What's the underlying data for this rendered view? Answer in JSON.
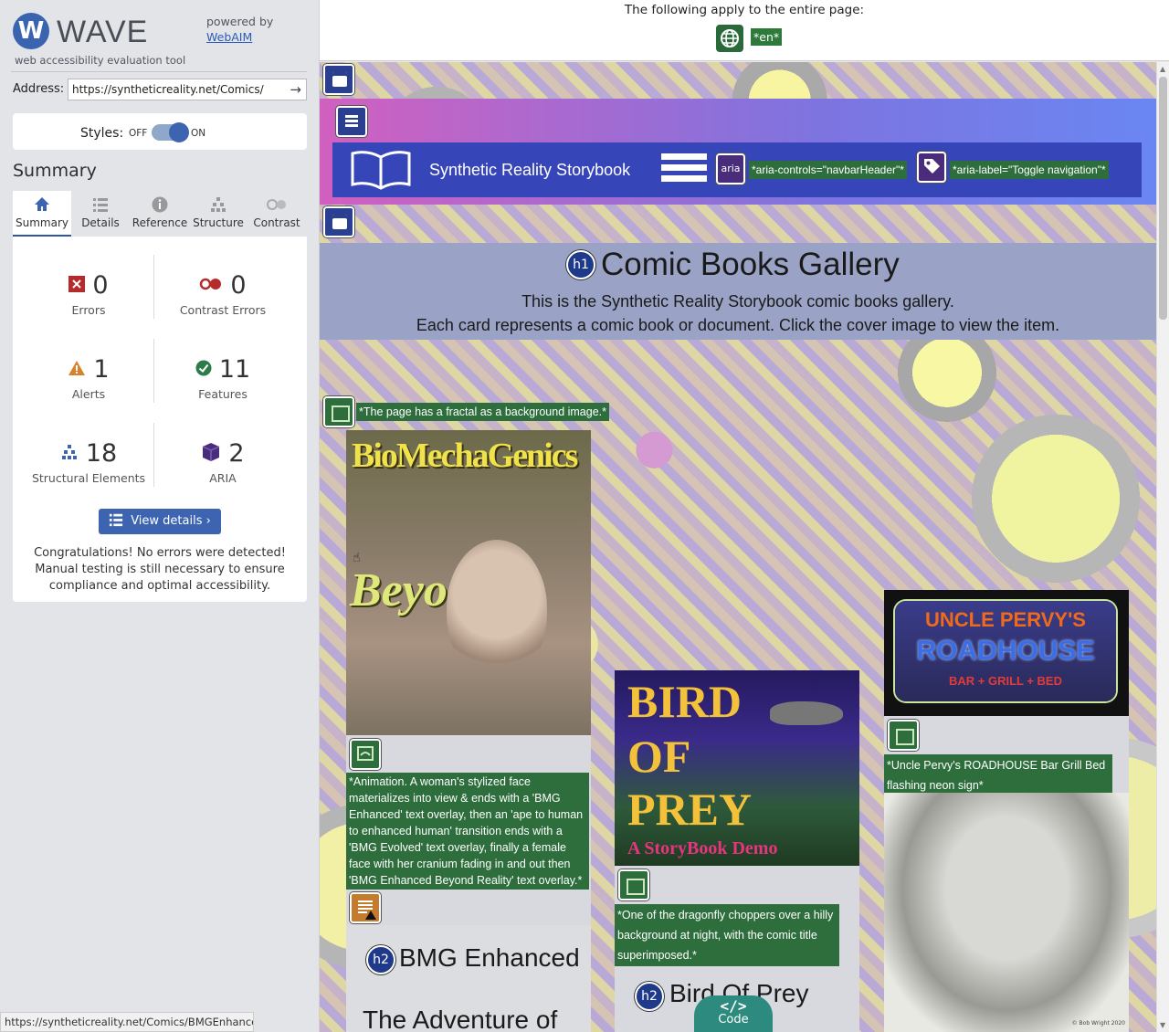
{
  "wave": {
    "logo_mark": "W",
    "logo_text": "WAVE",
    "logo_sub": "web accessibility evaluation tool",
    "powered_by": "powered by",
    "webaim_link": "WebAIM",
    "address_label": "Address:",
    "address_value": "https://syntheticreality.net/Comics/",
    "address_go": "→",
    "styles_label": "Styles:",
    "styles_off": "OFF",
    "styles_on": "ON",
    "summary_heading": "Summary",
    "tabs": [
      {
        "label": "Summary",
        "icon": "home-icon"
      },
      {
        "label": "Details",
        "icon": "list-icon"
      },
      {
        "label": "Reference",
        "icon": "info-icon"
      },
      {
        "label": "Structure",
        "icon": "structure-icon"
      },
      {
        "label": "Contrast",
        "icon": "contrast-icon"
      }
    ],
    "stats": {
      "errors": {
        "num": "0",
        "label": "Errors"
      },
      "contrast_errors": {
        "num": "0",
        "label": "Contrast Errors"
      },
      "alerts": {
        "num": "1",
        "label": "Alerts"
      },
      "features": {
        "num": "11",
        "label": "Features"
      },
      "structural": {
        "num": "18",
        "label": "Structural Elements"
      },
      "aria": {
        "num": "2",
        "label": "ARIA"
      }
    },
    "view_details": "View details ›",
    "congrats": "Congratulations! No errors were detected! Manual testing is still necessary to ensure compliance and optimal accessibility.",
    "status_url": "https://syntheticreality.net/Comics/BMGEnhanced.html"
  },
  "banner": {
    "text": "The following apply to the entire page:",
    "lang_badge": "*en*"
  },
  "page": {
    "brand": "Synthetic Reality Storybook",
    "aria_label_icon": "aria",
    "aria_controls": "*aria-controls=\"navbarHeader\"*",
    "aria_label": "*aria-label=\"Toggle navigation\"*",
    "h1_badge": "h1",
    "h1": "Comic Books Gallery",
    "sub1": "This is the Synthetic Reality Storybook comic books gallery.",
    "sub2": "Each card represents a comic book or document. Click the cover image to view the item.",
    "bg_alt": "*The page has a fractal as a background image.*",
    "cards": [
      {
        "cover_title": "BioMechaGenics",
        "cover_sub": "Beyond",
        "alt": "*Animation. A woman's stylized face materializes into view & ends with a 'BMG Enhanced' text overlay, then an 'ape to human to enhanced human' transition ends with a 'BMG Evolved' text overlay, finally a female face with her cranium fading in and out then 'BMG Enhanced Beyond Reality' text overlay.*",
        "h2_badge": "h2",
        "h2": "BMG Enhanced",
        "next_line": "The Adventure of"
      },
      {
        "cover_line1": "BIRD",
        "cover_line2": "OF",
        "cover_line3": "PREY",
        "cover_tag": "A StoryBook Demo",
        "alt": "*One of the dragonfly choppers over a hilly background at night, with the comic title superimposed.*",
        "h2_badge": "h2",
        "h2": "Bird Of Prey"
      },
      {
        "cover_line1": "UNCLE PERVY'S",
        "cover_line2": "ROADHOUSE",
        "cover_line3": "BAR + GRILL + BED",
        "alt": "*Uncle Pervy's ROADHOUSE Bar Grill Bed flashing neon sign*",
        "credit": "© Bob Wright 2020"
      }
    ],
    "code_tab_symbol": "</>",
    "code_tab_label": "Code"
  },
  "colors": {
    "wave_blue": "#3c64b1",
    "feature_green": "#2d6e3c",
    "aria_purple": "#4a2d7a",
    "navbar": "#3645b8",
    "error_red": "#b52b2b",
    "alert_orange": "#d9822b"
  }
}
